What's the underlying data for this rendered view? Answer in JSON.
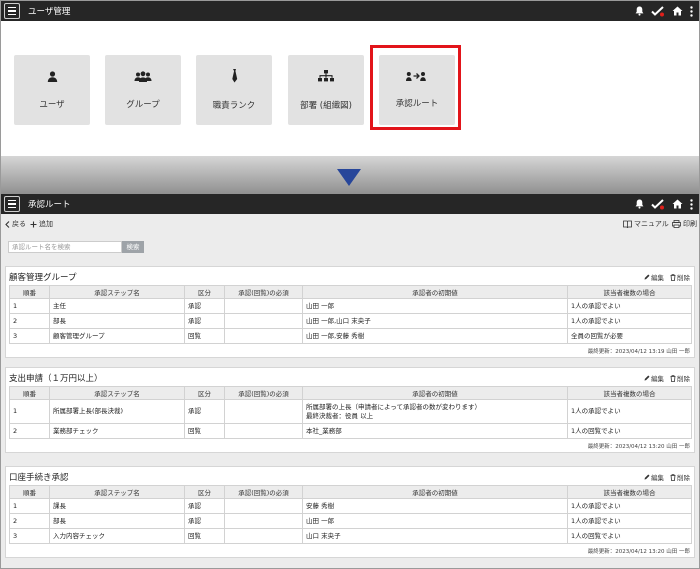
{
  "top_header": {
    "title": "ユーザ管理"
  },
  "tiles": [
    {
      "label": "ユーザ",
      "icon": "user-icon"
    },
    {
      "label": "グループ",
      "icon": "group-icon"
    },
    {
      "label": "職責ランク",
      "icon": "necktie-icon"
    },
    {
      "label": "部署 (組織図)",
      "icon": "org-chart-icon"
    },
    {
      "label": "承認ルート",
      "icon": "approval-route-icon"
    }
  ],
  "highlight_color": "#e2141a",
  "arrow_color": "#27469a",
  "bottom_header": {
    "title": "承認ルート"
  },
  "toolbar": {
    "back": "戻る",
    "add": "追加",
    "manual": "マニュアル",
    "print": "印刷"
  },
  "search": {
    "placeholder": "承認ルート名を検索",
    "button": "検索"
  },
  "columns": [
    "順番",
    "承認ステップ名",
    "区分",
    "承認(回覧)の必須",
    "承認者の初期値",
    "該当者複数の場合"
  ],
  "panel_actions": {
    "edit": "編集",
    "delete": "削除"
  },
  "routes": [
    {
      "name": "顧客管理グループ",
      "rows": [
        [
          "1",
          "主任",
          "承認",
          "",
          "山田 一郎",
          "1人の承認でよい"
        ],
        [
          "2",
          "部長",
          "承認",
          "",
          "山田 一郎,山口 末央子",
          "1人の承認でよい"
        ],
        [
          "3",
          "顧客管理グループ",
          "回覧",
          "",
          "山田 一郎,安藤 秀樹",
          "全員の回覧が必要"
        ]
      ],
      "updated": "最終更新：2023/04/12 13:19 山田 一郎"
    },
    {
      "name": "支出申請（１万円以上）",
      "rows": [
        [
          "1",
          "所属部署上長(部長決裁)",
          "承認",
          "",
          "所属部署の上長（申請者によって承認者の数が変わります）\n最終決裁者：役員 以上",
          "1人の承認でよい"
        ],
        [
          "2",
          "業務部チェック",
          "回覧",
          "",
          "本社_業務部",
          "1人の回覧でよい"
        ]
      ],
      "updated": "最終更新：2023/04/12 13:20 山田 一郎"
    },
    {
      "name": "口座手続き承認",
      "rows": [
        [
          "1",
          "課長",
          "承認",
          "",
          "安藤 秀樹",
          "1人の承認でよい"
        ],
        [
          "2",
          "部長",
          "承認",
          "",
          "山田 一郎",
          "1人の承認でよい"
        ],
        [
          "3",
          "入力内容チェック",
          "回覧",
          "",
          "山口 末央子",
          "1人の回覧でよい"
        ]
      ],
      "updated": "最終更新：2023/04/12 13:20 山田 一郎"
    }
  ]
}
